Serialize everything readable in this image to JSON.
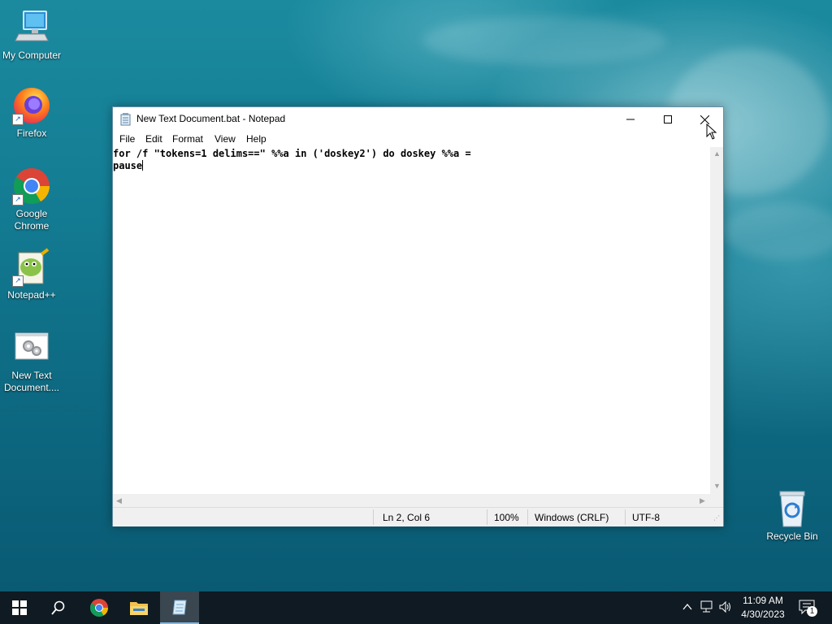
{
  "desktop": {
    "icons": [
      {
        "label": "My Computer",
        "icon": "computer-icon"
      },
      {
        "label": "Firefox",
        "icon": "firefox-icon"
      },
      {
        "label": "Google Chrome",
        "icon": "chrome-icon"
      },
      {
        "label": "Notepad++",
        "icon": "notepadpp-icon"
      },
      {
        "label": "New Text Document....",
        "icon": "batch-file-icon"
      },
      {
        "label": "Recycle Bin",
        "icon": "recycle-bin-icon"
      }
    ]
  },
  "notepad": {
    "title": "New Text Document.bat - Notepad",
    "menu": [
      "File",
      "Edit",
      "Format",
      "View",
      "Help"
    ],
    "content": {
      "line1": "for /f \"tokens=1 delims==\" %%a in ('doskey2') do doskey %%a =",
      "line2": "pause"
    },
    "status": {
      "position": "Ln 2, Col 6",
      "zoom": "100%",
      "line_ending": "Windows (CRLF)",
      "encoding": "UTF-8"
    }
  },
  "taskbar": {
    "time": "11:09 AM",
    "date": "4/30/2023",
    "notification_count": "1",
    "pinned": [
      "start-icon",
      "search-icon",
      "chrome-icon",
      "file-explorer-icon",
      "notepad-icon"
    ],
    "tray_icons": [
      "chevron-up-icon",
      "network-icon",
      "volume-icon"
    ]
  },
  "colors": {
    "taskbar": "#101a22",
    "desktop_base": "#137c93",
    "active_task": "#3a4650"
  }
}
